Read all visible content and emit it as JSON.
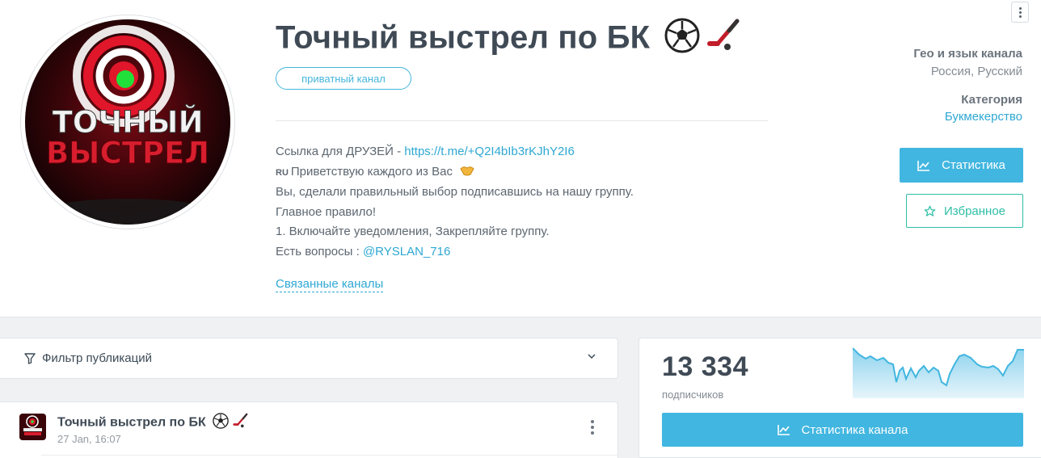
{
  "channel": {
    "title": "Точный выстрел по БК",
    "title_emoji": "soccer-ball-and-hockey-stick",
    "type_badge": "приватный канал",
    "avatar_text": [
      "ТОЧНЫЙ",
      "ВЫСТРЕЛ"
    ],
    "description": {
      "line1_prefix": "Ссылка для ДРУЗЕЙ - ",
      "line1_link": "https://t.me/+Q2I4bIb3rKJhY2I6",
      "line2_flag": "RU",
      "line2_text": "Приветствую каждого из Вас",
      "line3": "Вы, сделали правильный выбор подписавшись на нашу группу.",
      "line4": "Главное правило!",
      "line5": "1. Включайте уведомления, Закрепляйте группу.",
      "line6_prefix": "Есть вопросы : ",
      "line6_link": "@RYSLAN_716"
    },
    "related_label": "Связанные каналы"
  },
  "sidebar": {
    "geo_label": "Гео и язык канала",
    "geo_value": "Россия, Русский",
    "category_label": "Категория",
    "category_value": "Букмекерство",
    "stats_button": "Статистика",
    "favorite_button": "Избранное"
  },
  "filter": {
    "label": "Фильтр публикаций"
  },
  "post": {
    "title": "Точный выстрел по БК",
    "date": "27 Jan, 16:07"
  },
  "stats": {
    "subscribers": "13 334",
    "subscribers_label": "подписчиков",
    "channel_stats_button": "Статистика канала"
  },
  "colors": {
    "accent": "#41b6e0",
    "link": "#2ea8d3",
    "favorite": "#2fbea5",
    "text_dark": "#3f4a55"
  }
}
